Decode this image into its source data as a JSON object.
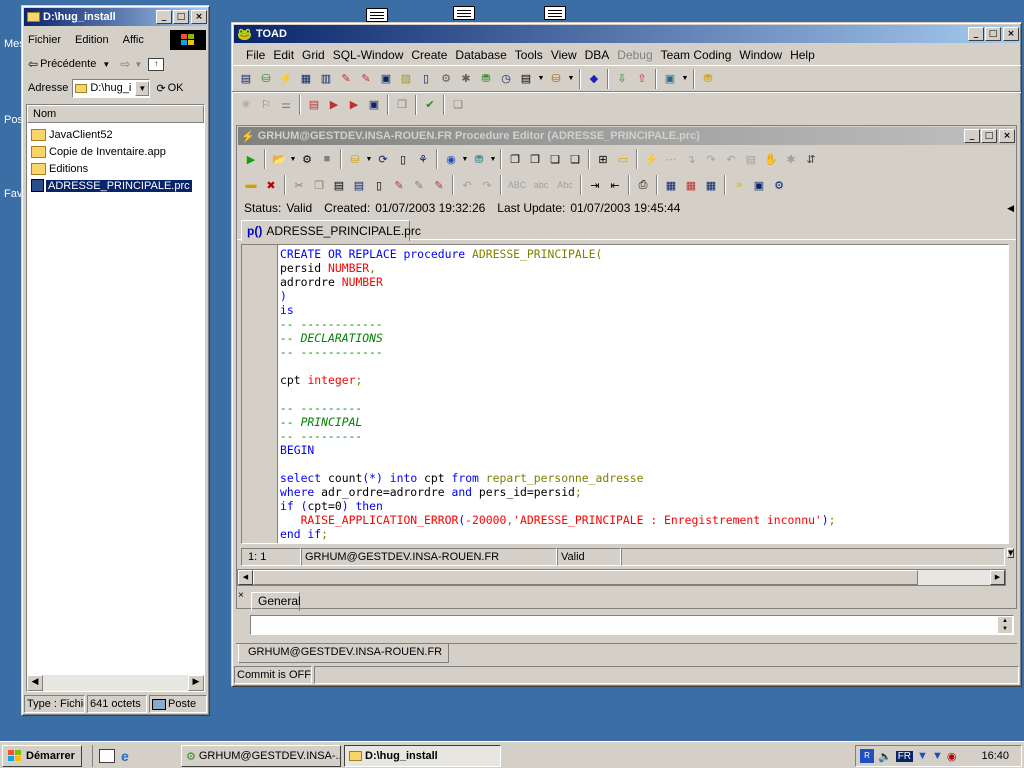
{
  "desktop": {
    "labels": [
      "Mes",
      "Pos",
      "Fav"
    ]
  },
  "explorer": {
    "title": "D:\\hug_install",
    "menu": [
      "Fichier",
      "Edition",
      "Affic"
    ],
    "back_label": "Précédente",
    "address_label": "Adresse",
    "address_value": "D:\\hug_i",
    "ok_label": "OK",
    "column_name": "Nom",
    "files": [
      {
        "name": "JavaClient52",
        "icon": "folder-icon",
        "selected": false
      },
      {
        "name": "Copie de Inventaire.app",
        "icon": "folder-icon",
        "selected": false
      },
      {
        "name": "Editions",
        "icon": "folder-icon",
        "selected": false
      },
      {
        "name": "ADRESSE_PRINCIPALE.prc",
        "icon": "file-icon",
        "selected": true
      }
    ],
    "status_type": "Type : Fichie",
    "status_size": "641 octets",
    "status_zone": "Poste"
  },
  "toad": {
    "title": "TOAD",
    "menu": [
      "File",
      "Edit",
      "Grid",
      "SQL-Window",
      "Create",
      "Database",
      "Tools",
      "View",
      "DBA",
      "Debug",
      "Team Coding",
      "Window",
      "Help"
    ],
    "menu_disabled": [
      "Debug"
    ],
    "editor_title": "GRHUM@GESTDEV.INSA-ROUEN.FR Procedure Editor (ADRESSE_PRINCIPALE.prc)",
    "status_label": "Status:",
    "status_value": "Valid",
    "created_label": "Created:",
    "created_value": "01/07/2003 19:32:26",
    "update_label": "Last Update:",
    "update_value": "01/07/2003 19:45:44",
    "file_tab": "ADRESSE_PRINCIPALE.prc",
    "code_lines": [
      [
        [
          "kw",
          "CREATE OR REPLACE procedure "
        ],
        [
          "id",
          "ADRESSE_PRINCIPALE"
        ],
        [
          "id",
          "("
        ]
      ],
      [
        [
          "",
          "persid "
        ],
        [
          "ty",
          "NUMBER"
        ],
        [
          "id",
          ","
        ]
      ],
      [
        [
          "",
          "adrordre "
        ],
        [
          "ty",
          "NUMBER"
        ]
      ],
      [
        [
          "kw",
          ")"
        ]
      ],
      [
        [
          "kw",
          "is"
        ]
      ],
      [
        [
          "cm",
          "-- ------------"
        ]
      ],
      [
        [
          "cm",
          "-- DECLARATIONS"
        ]
      ],
      [
        [
          "cm",
          "-- ------------"
        ]
      ],
      [
        [
          "",
          ""
        ]
      ],
      [
        [
          "",
          "cpt "
        ],
        [
          "ty",
          "integer"
        ],
        [
          "id",
          ";"
        ]
      ],
      [
        [
          "",
          ""
        ]
      ],
      [
        [
          "cm",
          "-- ---------"
        ]
      ],
      [
        [
          "cm",
          "-- PRINCIPAL"
        ]
      ],
      [
        [
          "cm",
          "-- ---------"
        ]
      ],
      [
        [
          "kw",
          "BEGIN"
        ]
      ],
      [
        [
          "",
          ""
        ]
      ],
      [
        [
          "kw",
          "select "
        ],
        [
          "",
          "count"
        ],
        [
          "kw",
          "(*)"
        ],
        [
          "kw",
          " into "
        ],
        [
          "",
          "cpt "
        ],
        [
          "kw",
          "from "
        ],
        [
          "id",
          "repart_personne_adresse"
        ]
      ],
      [
        [
          "kw",
          "where "
        ],
        [
          "",
          "adr_ordre=adrordre "
        ],
        [
          "kw",
          "and "
        ],
        [
          "",
          "pers_id=persid"
        ],
        [
          "id",
          ";"
        ]
      ],
      [
        [
          "kw",
          "if "
        ],
        [
          "kw",
          "("
        ],
        [
          "",
          "cpt=0"
        ],
        [
          "kw",
          ")"
        ],
        [
          "kw",
          " then"
        ]
      ],
      [
        [
          "",
          "   "
        ],
        [
          "ty",
          "RAISE_APPLICATION_ERROR"
        ],
        [
          "kw",
          "("
        ],
        [
          "ty",
          "-20000"
        ],
        [
          "id",
          ","
        ],
        [
          "st",
          "'ADRESSE_PRINCIPALE : Enregistrement inconnu'"
        ],
        [
          "kw",
          ")"
        ],
        [
          "id",
          ";"
        ]
      ],
      [
        [
          "kw",
          "end if"
        ],
        [
          "id",
          ";"
        ]
      ]
    ],
    "pos": "1:  1",
    "conn": "GRHUM@GESTDEV.INSA-ROUEN.FR",
    "valid": "Valid",
    "general_tab": "General",
    "bottom_conn_tab": "GRHUM@GESTDEV.INSA-ROUEN.FR",
    "commit_status": "Commit is OFF"
  },
  "taskbar": {
    "start": "Démarrer",
    "tasks": [
      "GRHUM@GESTDEV.INSA-...",
      "D:\\hug_install"
    ],
    "lang": "FR",
    "clock": "16:40"
  }
}
